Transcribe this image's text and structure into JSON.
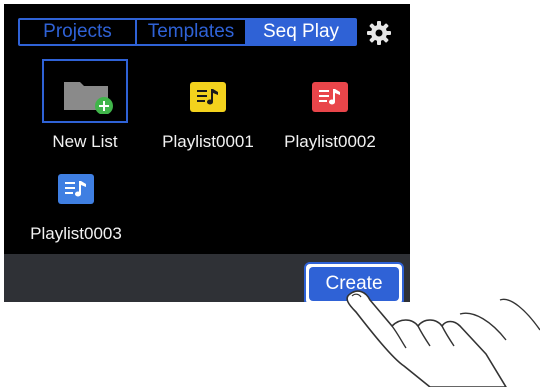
{
  "tabs": [
    {
      "label": "Projects",
      "active": false
    },
    {
      "label": "Templates",
      "active": false
    },
    {
      "label": "Seq Play",
      "active": true
    }
  ],
  "items": [
    {
      "label": "New List",
      "icon": "folder-add-icon",
      "selected": true
    },
    {
      "label": "Playlist0001",
      "icon": "playlist-icon",
      "color": "#f3d21d"
    },
    {
      "label": "Playlist0002",
      "icon": "playlist-icon",
      "color": "#e9454a"
    },
    {
      "label": "Playlist0003",
      "icon": "playlist-icon",
      "color": "#3f7fe2"
    }
  ],
  "footer": {
    "create_label": "Create"
  },
  "colors": {
    "accent": "#2f62d6",
    "background": "#000000",
    "footer": "#2f3136"
  }
}
